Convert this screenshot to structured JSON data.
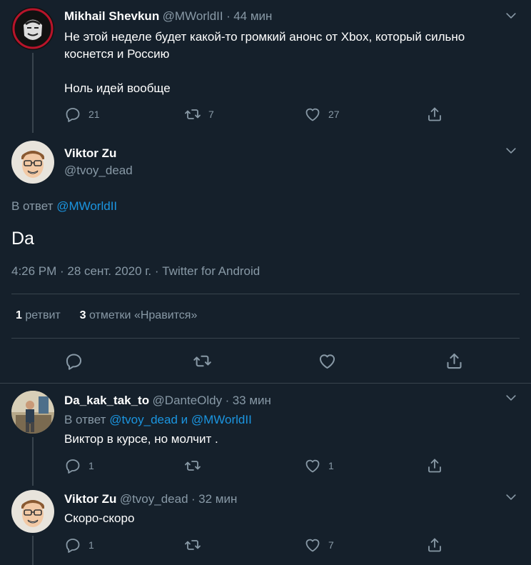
{
  "tweet1": {
    "name": "Mikhail Shevkun",
    "handle": "@MWorldII",
    "time": "44 мин",
    "text_line1": "Не этой неделе будет какой-то громкий анонс от Xbox, который сильно",
    "text_line2": "коснется и Россию",
    "text_line3": "Ноль идей вообще",
    "replies": "21",
    "retweets": "7",
    "likes": "27"
  },
  "main": {
    "name": "Viktor Zu",
    "handle": "@tvoy_dead",
    "reply_prefix": "В ответ",
    "reply_to": "@MWorldII",
    "text": "Da",
    "timestamp": "4:26 PM · 28 сент. 2020 г. · Twitter for Android",
    "retweet_count": "1",
    "retweet_label": "ретвит",
    "like_count": "3",
    "like_label": "отметки «Нравится»"
  },
  "reply1": {
    "name": "Da_kak_tak_to",
    "handle": "@DanteOldy",
    "time": "33 мин",
    "reply_prefix": "В ответ",
    "reply_to_1": "@tvoy_dead",
    "reply_and": "и",
    "reply_to_2": "@MWorldII",
    "text": "Виктор в курсе, но молчит .",
    "replies": "1",
    "likes": "1"
  },
  "reply2": {
    "name": "Viktor Zu",
    "handle": "@tvoy_dead",
    "time": "32 мин",
    "text": "Скоро-скоро",
    "replies": "1",
    "likes": "7"
  },
  "separator": "·",
  "icons": {
    "reply": "reply-icon",
    "retweet": "retweet-icon",
    "like": "heart-icon",
    "share": "share-icon",
    "more": "chevron-down-icon"
  },
  "colors": {
    "background": "#15202b",
    "accent": "#1b95e0",
    "muted": "#8899a6",
    "divider": "#38444d"
  }
}
